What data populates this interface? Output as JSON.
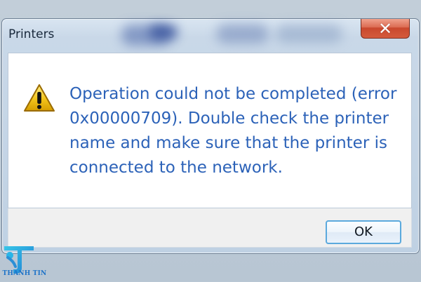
{
  "dialog": {
    "title": "Printers",
    "close_glyph": "✕",
    "message": "Operation could not be completed (error 0x00000709). Double check the printer name and make sure that the printer is connected to the network.",
    "ok_label": "OK"
  },
  "icons": {
    "warning": "warning-icon",
    "close": "close-icon",
    "brand": "brand-logo-icon"
  },
  "watermark": {
    "text": "THANH TIN"
  },
  "colors": {
    "message_text": "#2c62b8",
    "warning_fill": "#f3c41b",
    "close_button": "#d45b3d",
    "ok_border": "#5ba9dd"
  }
}
